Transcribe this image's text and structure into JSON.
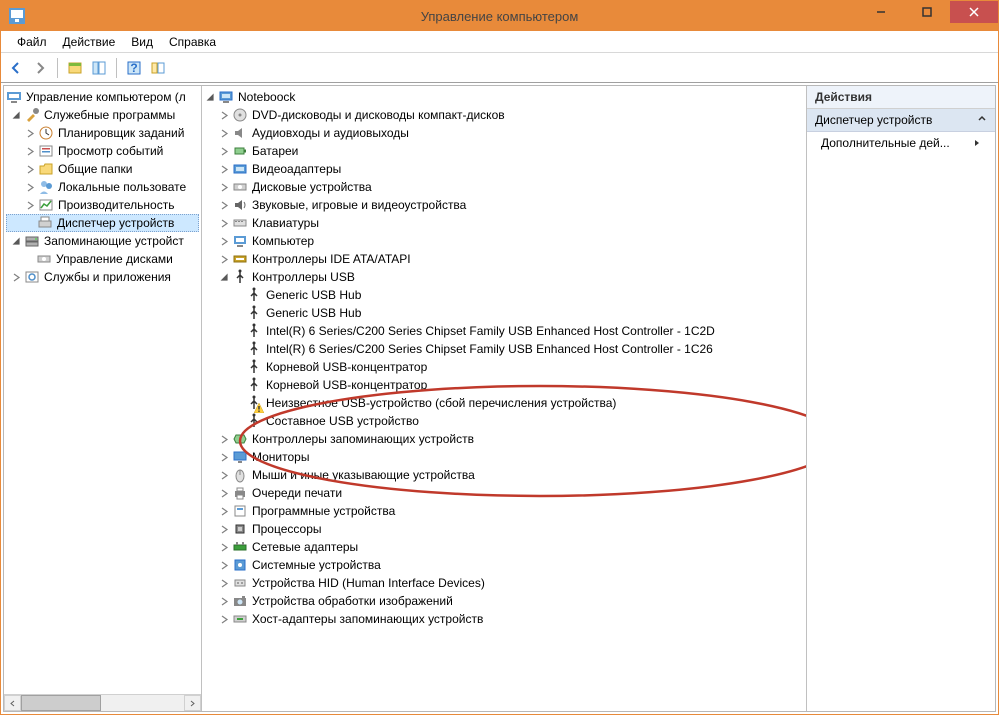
{
  "window": {
    "title": "Управление компьютером"
  },
  "menu": {
    "file": "Файл",
    "action": "Действие",
    "view": "Вид",
    "help": "Справка"
  },
  "left_tree": {
    "root": "Управление компьютером (л",
    "sys_tools": "Служебные программы",
    "scheduler": "Планировщик заданий",
    "events": "Просмотр событий",
    "shared": "Общие папки",
    "localusers": "Локальные пользовате",
    "perf": "Производительность",
    "devmgr": "Диспетчер устройств",
    "storage": "Запоминающие устройст",
    "diskmgr": "Управление дисками",
    "services": "Службы и приложения"
  },
  "device_root": "Noteboock",
  "categories": {
    "dvd": "DVD-дисководы и дисководы компакт-дисков",
    "audio": "Аудиовходы и аудиовыходы",
    "battery": "Батареи",
    "video": "Видеоадаптеры",
    "disk": "Дисковые устройства",
    "sound": "Звуковые, игровые и видеоустройства",
    "keyboard": "Клавиатуры",
    "computer": "Компьютер",
    "ide": "Контроллеры IDE ATA/ATAPI",
    "usb": "Контроллеры USB",
    "storagectrl": "Контроллеры запоминающих устройств",
    "monitor": "Мониторы",
    "mouse": "Мыши и иные указывающие устройства",
    "print": "Очереди печати",
    "software": "Программные устройства",
    "cpu": "Процессоры",
    "net": "Сетевые адаптеры",
    "sys": "Системные устройства",
    "hid": "Устройства HID (Human Interface Devices)",
    "imaging": "Устройства обработки изображений",
    "hostadapter": "Хост-адаптеры запоминающих устройств"
  },
  "usb_devices": {
    "d0": "Generic USB Hub",
    "d1": "Generic USB Hub",
    "d2": "Intel(R) 6 Series/C200 Series Chipset Family USB Enhanced Host Controller - 1C2D",
    "d3": "Intel(R) 6 Series/C200 Series Chipset Family USB Enhanced Host Controller - 1C26",
    "d4": "Корневой USB-концентратор",
    "d5": "Корневой USB-концентратор",
    "d6": "Неизвестное USB-устройство (сбой перечисления устройства)",
    "d7": "Составное USB устройство"
  },
  "actions": {
    "header": "Действия",
    "section": "Диспетчер устройств",
    "more": "Дополнительные дей..."
  }
}
